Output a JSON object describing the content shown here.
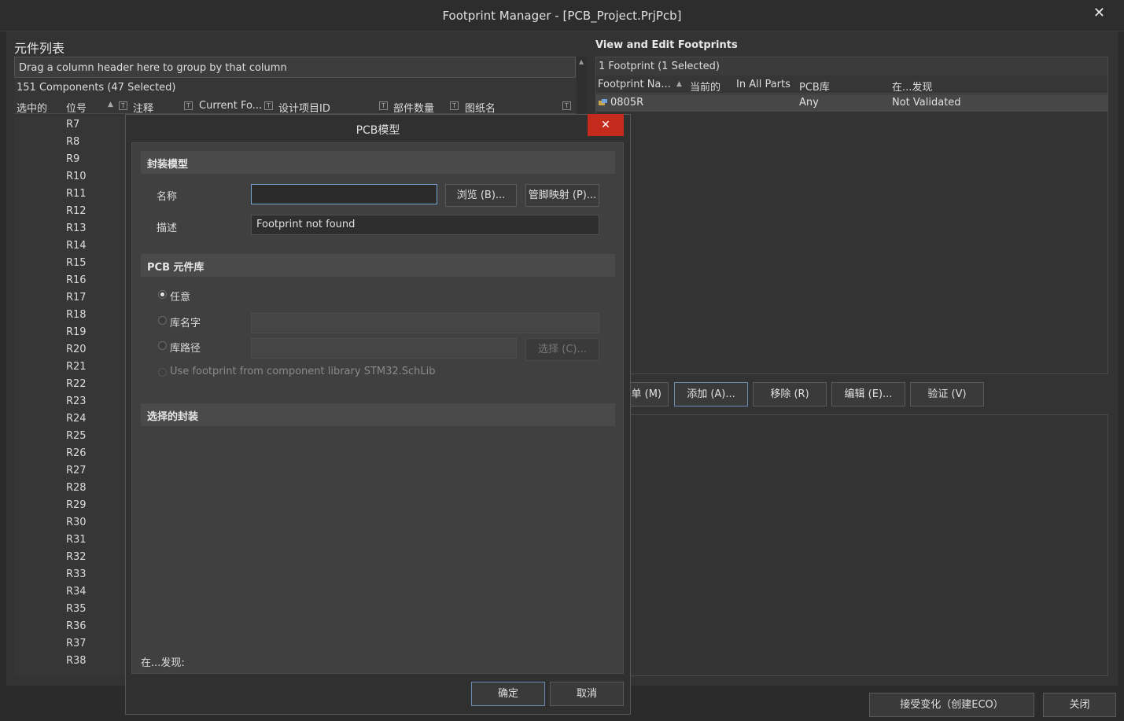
{
  "window": {
    "title": "Footprint Manager - [PCB_Project.PrjPcb]"
  },
  "left_panel": {
    "title": "元件列表",
    "group_hint": "Drag a column header here to group by that column",
    "count": "151 Components (47 Selected)",
    "columns": [
      "选中的",
      "位号",
      "注释",
      "Current Fo...",
      "设计项目ID",
      "部件数量",
      "图纸名"
    ],
    "rows": [
      "R7",
      "R8",
      "R9",
      "R10",
      "R11",
      "R12",
      "R13",
      "R14",
      "R15",
      "R16",
      "R17",
      "R18",
      "R19",
      "R20",
      "R21",
      "R22",
      "R23",
      "R24",
      "R25",
      "R26",
      "R27",
      "R28",
      "R29",
      "R30",
      "R31",
      "R32",
      "R33",
      "R34",
      "R35",
      "R36",
      "R37",
      "R38"
    ]
  },
  "right_panel": {
    "title": "View and Edit Footprints",
    "count": "1 Footprint (1 Selected)",
    "columns": [
      "Footprint Na...",
      "当前的",
      "In All Parts",
      "PCB库",
      "在...发现"
    ],
    "row": {
      "name": "0805R",
      "library": "Any",
      "found_in": "Not Validated"
    },
    "buttons": {
      "menu": "单 (M)",
      "add": "添加 (A)...",
      "remove": "移除 (R)",
      "edit": "编辑 (E)...",
      "validate": "验证 (V)"
    }
  },
  "modal": {
    "title": "PCB模型",
    "close_icon": "✕",
    "sections": {
      "model": "封装模型",
      "library": "PCB 元件库",
      "selected": "选择的封装"
    },
    "name_label": "名称",
    "name_value": "",
    "desc_label": "描述",
    "desc_value": "Footprint not found",
    "browse": "浏览 (B)...",
    "pin_map": "管脚映射 (P)...",
    "opt_any": "任意",
    "opt_libname": "库名字",
    "opt_libpath": "库路径",
    "choose": "选择 (C)...",
    "opt_use_lib": "Use footprint from component library STM32.SchLib",
    "found_in": "在...发现:",
    "ok": "确定",
    "cancel": "取消"
  },
  "footer": {
    "accept": "接受变化（创建ECO）",
    "close": "关闭"
  },
  "colors": {
    "accent": "#7aa3d6",
    "close_red": "#c42b1c"
  }
}
